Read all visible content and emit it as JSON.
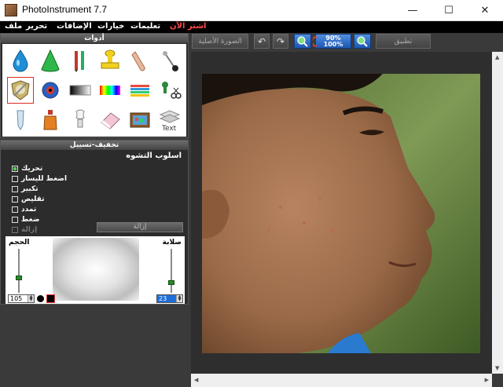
{
  "window": {
    "title": "PhotoInstrument 7.7",
    "minimize": "—",
    "maximize": "☐",
    "close": "✕"
  },
  "menu": {
    "file": "ملف",
    "edit": "تحرير",
    "plugins": "الإضافات",
    "options": "خيارات",
    "tutorials": "تعليمات",
    "buy_now": "اشتر الآن"
  },
  "tools_panel": {
    "title": "أدوات",
    "tools": [
      "water-drop-icon",
      "cone-icon",
      "brush-pencil-icon",
      "stamp-icon",
      "finger-smudge-icon",
      "pin-handle-icon",
      "shield-smooth-icon",
      "eye-icon",
      "gradient-icon",
      "rainbow-icon",
      "palette-lines-icon",
      "clone-scissors-icon",
      "tube-icon",
      "perfume-bottle-icon",
      "light-bulb-icon",
      "eraser-icon",
      "tv-frame-icon",
      "text-layers-icon"
    ],
    "selected_index": 6
  },
  "param_panel": {
    "title": "تخفيف-تسييل",
    "mode_title": "اسلوب التشوه",
    "options": [
      {
        "label": "تحريك",
        "checked": true,
        "enabled": true
      },
      {
        "label": "اضغط لليسار",
        "checked": false,
        "enabled": true
      },
      {
        "label": "تكبير",
        "checked": false,
        "enabled": true
      },
      {
        "label": "تقليص",
        "checked": false,
        "enabled": true
      },
      {
        "label": "تمدد",
        "checked": false,
        "enabled": true
      },
      {
        "label": "ضغط",
        "checked": false,
        "enabled": true
      },
      {
        "label": "إزالة",
        "checked": false,
        "enabled": false
      }
    ],
    "remove_button": "إزالة",
    "brush": {
      "size_label": "الحجم",
      "hardness_label": "صلابة",
      "size_value": "105",
      "hardness_value": "23"
    }
  },
  "toolbar": {
    "original_image": "الصورة الأصلية",
    "undo": "↶",
    "redo": "↷",
    "zoom_in": "zoom-in-icon",
    "zoom_fit": "zoom-fit-icon",
    "zoom_out": "zoom-out-icon",
    "zoom_top": "90%",
    "zoom_bottom": "100%",
    "apply": "تطبيق"
  },
  "colors": {
    "accent": "#1d56b0",
    "buy_now": "#ff4a4a",
    "panel_bg": "#2c2c2c",
    "selected_tool_border": "#e0291f"
  }
}
